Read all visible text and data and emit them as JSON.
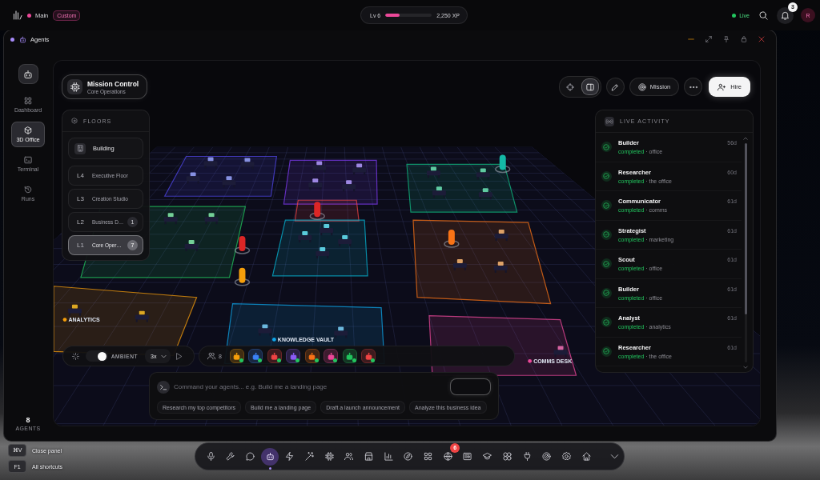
{
  "top_bar": {
    "workspace": "Main",
    "mode_badge": "Custom",
    "xp": {
      "label": "Lv 6",
      "level": 0.3,
      "value": "2,250 XP"
    },
    "status": "Live",
    "notifications": "3",
    "avatar": "R"
  },
  "window": {
    "title": "Agents"
  },
  "rail": {
    "items": [
      {
        "label": "Dashboard",
        "selected": false
      },
      {
        "label": "3D Office",
        "selected": true
      },
      {
        "label": "Terminal",
        "selected": false
      },
      {
        "label": "Runs",
        "selected": false
      }
    ],
    "agent_count": "8",
    "agent_count_label": "AGENTS"
  },
  "mission_card": {
    "title": "Mission Control",
    "subtitle": "Core Operations"
  },
  "floors": {
    "title": "FLOORS",
    "items": [
      {
        "kind": "building",
        "label": "Building",
        "selected": false
      },
      {
        "kind": "floor",
        "level": "L4",
        "label": "Executive Floor",
        "selected": false
      },
      {
        "kind": "floor",
        "level": "L3",
        "label": "Creation Studio",
        "selected": false
      },
      {
        "kind": "floor",
        "level": "L2",
        "label": "Business D…",
        "count": "1",
        "selected": false
      },
      {
        "kind": "floor",
        "level": "L1",
        "label": "Core Oper…",
        "count": "7",
        "selected": true
      }
    ]
  },
  "toolbar": {
    "views": [
      {
        "selected": false
      },
      {
        "selected": true
      }
    ],
    "mission": "Mission",
    "hire": "Hire"
  },
  "live_activity": {
    "title": "LIVE ACTIVITY",
    "items": [
      {
        "agent": "Builder",
        "status": "completed",
        "detail": "· office",
        "time": "56d"
      },
      {
        "agent": "Researcher",
        "status": "completed",
        "detail": "· the office",
        "time": "60d"
      },
      {
        "agent": "Communicator",
        "status": "completed",
        "detail": "· comms",
        "time": "61d"
      },
      {
        "agent": "Strategist",
        "status": "completed",
        "detail": "· marketing",
        "time": "61d"
      },
      {
        "agent": "Scout",
        "status": "completed",
        "detail": "· office",
        "time": "61d"
      },
      {
        "agent": "Builder",
        "status": "completed",
        "detail": "· office",
        "time": "61d"
      },
      {
        "agent": "Analyst",
        "status": "completed",
        "detail": "· analytics",
        "time": "61d"
      },
      {
        "agent": "Researcher",
        "status": "completed",
        "detail": "· the office",
        "time": "61d"
      }
    ]
  },
  "scene": {
    "zones": [
      {
        "label": "ANALYTICS",
        "color": "#f59e0b"
      },
      {
        "label": "KNOWLEDGE VAULT",
        "color": "#0ea5e9"
      },
      {
        "label": "COMMS DESK",
        "color": "#ec4899"
      }
    ]
  },
  "controls": {
    "ambient": {
      "label": "AMBIENT",
      "on": true
    },
    "speed": "3x",
    "agent_count": "8",
    "agents": [
      {
        "color": "#f59e0b",
        "online": true
      },
      {
        "color": "#3b82f6",
        "online": true
      },
      {
        "color": "#ef4444",
        "online": true
      },
      {
        "color": "#8b5cf6",
        "online": true
      },
      {
        "color": "#f97316",
        "online": true
      },
      {
        "color": "#ec4899",
        "online": true
      },
      {
        "color": "#22c55e",
        "online": true
      },
      {
        "color": "#ef4444",
        "online": true
      }
    ]
  },
  "command": {
    "placeholder": "Command your agents... e.g. Build me a landing page",
    "suggestions": [
      "Research my top competitors",
      "Build me a landing page",
      "Draft a launch announcement",
      "Analyze this business idea"
    ]
  },
  "shortcuts": [
    {
      "key": "⌘V",
      "label": "Close panel"
    },
    {
      "key": "F1",
      "label": "All shortcuts"
    }
  ],
  "dock": {
    "items": [
      {
        "selected": false
      },
      {
        "selected": false
      },
      {
        "selected": false
      },
      {
        "selected": true
      },
      {
        "selected": false
      },
      {
        "selected": false
      },
      {
        "selected": false
      },
      {
        "selected": false
      },
      {
        "selected": false
      },
      {
        "selected": false
      },
      {
        "selected": false
      },
      {
        "selected": false
      },
      {
        "selected": false,
        "badge": "6"
      },
      {
        "selected": false
      },
      {
        "selected": false
      },
      {
        "selected": false
      },
      {
        "selected": false
      },
      {
        "selected": false
      },
      {
        "selected": false
      },
      {
        "selected": false
      }
    ]
  }
}
